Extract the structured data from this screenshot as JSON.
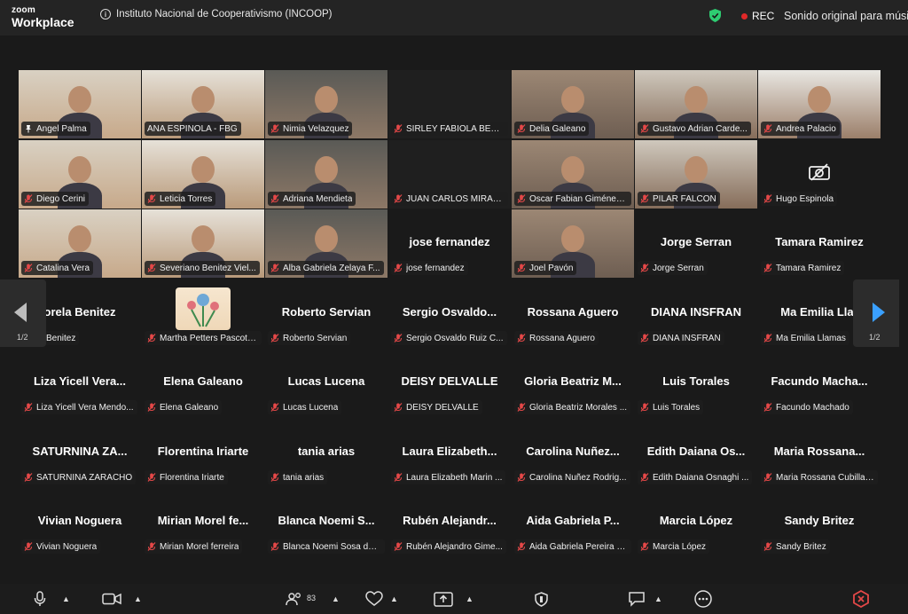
{
  "app": {
    "brand_line1": "zoom",
    "brand_line2": "Workplace"
  },
  "meeting": {
    "title": "Instituto Nacional de Cooperativismo (INCOOP)",
    "rec_label": "REC",
    "audio_label": "Sonido original para músi"
  },
  "pagination": {
    "left": "1/2",
    "right": "1/2"
  },
  "participant_count": "83",
  "rows": [
    [
      {
        "display": "",
        "label": "Angel Palma",
        "kind": "video",
        "icon": "pin-icon"
      },
      {
        "display": "",
        "label": "ANA ESPINOLA - FBG",
        "kind": "video",
        "icon": ""
      },
      {
        "display": "",
        "label": "Nimia Velazquez",
        "kind": "video",
        "icon": "mic-off-icon"
      },
      {
        "display": "",
        "label": "SIRLEY FABIOLA BENIT...",
        "kind": "dark",
        "icon": "mic-off-icon"
      },
      {
        "display": "",
        "label": "Delia Galeano",
        "kind": "video",
        "icon": "mic-off-icon"
      },
      {
        "display": "",
        "label": "Gustavo Adrian Carde...",
        "kind": "video",
        "icon": "mic-off-icon"
      },
      {
        "display": "",
        "label": "Andrea Palacio",
        "kind": "video",
        "icon": "mic-off-icon"
      }
    ],
    [
      {
        "display": "",
        "label": "Diego Cerini",
        "kind": "video",
        "icon": "mic-off-icon"
      },
      {
        "display": "",
        "label": "Leticia Torres",
        "kind": "video",
        "icon": "mic-off-icon"
      },
      {
        "display": "",
        "label": "Adriana Mendieta",
        "kind": "video",
        "icon": "mic-off-icon"
      },
      {
        "display": "",
        "label": "JUAN CARLOS MIRAN...",
        "kind": "dark",
        "icon": "mic-off-icon"
      },
      {
        "display": "",
        "label": "Oscar Fabian Giménez ...",
        "kind": "video",
        "icon": "mic-off-icon"
      },
      {
        "display": "",
        "label": "PILAR FALCON",
        "kind": "video",
        "icon": "mic-off-icon"
      },
      {
        "display": "",
        "label": "Hugo Espinola",
        "kind": "camera-off",
        "icon": "mic-off-icon"
      }
    ],
    [
      {
        "display": "",
        "label": "Catalina Vera",
        "kind": "video",
        "icon": "mic-off-icon"
      },
      {
        "display": "",
        "label": "Severiano Benitez Viel...",
        "kind": "video",
        "icon": "mic-off-icon"
      },
      {
        "display": "",
        "label": "Alba Gabriela Zelaya F...",
        "kind": "video",
        "icon": "mic-off-icon"
      },
      {
        "display": "jose fernandez",
        "label": "jose fernandez",
        "kind": "name",
        "icon": "mic-off-icon"
      },
      {
        "display": "",
        "label": "Joel Pavón",
        "kind": "video",
        "icon": "mic-off-icon"
      },
      {
        "display": "Jorge Serran",
        "label": "Jorge Serran",
        "kind": "name",
        "icon": "mic-off-icon"
      },
      {
        "display": "Tamara Ramirez",
        "label": "Tamara Ramirez",
        "kind": "name",
        "icon": "mic-off-icon"
      }
    ],
    [
      {
        "display": "orela Benitez",
        "label": "orela Benitez",
        "kind": "name",
        "icon": ""
      },
      {
        "display": "",
        "label": "Martha Petters Pascotti...",
        "kind": "avatar",
        "icon": "mic-off-icon"
      },
      {
        "display": "Roberto Servian",
        "label": "Roberto Servian",
        "kind": "name",
        "icon": "mic-off-icon"
      },
      {
        "display": "Sergio Osvaldo...",
        "label": "Sergio Osvaldo Ruiz C...",
        "kind": "name",
        "icon": "mic-off-icon"
      },
      {
        "display": "Rossana Aguero",
        "label": "Rossana Aguero",
        "kind": "name",
        "icon": "mic-off-icon"
      },
      {
        "display": "DIANA INSFRAN",
        "label": "DIANA INSFRAN",
        "kind": "name",
        "icon": "mic-off-icon"
      },
      {
        "display": "Ma Emilia Llar",
        "label": "Ma Emilia Llamas",
        "kind": "name",
        "icon": "mic-off-icon"
      }
    ],
    [
      {
        "display": "Liza Yicell Vera...",
        "label": "Liza Yicell Vera Mendo...",
        "kind": "name",
        "icon": "mic-off-icon"
      },
      {
        "display": "Elena Galeano",
        "label": "Elena Galeano",
        "kind": "name",
        "icon": "mic-off-icon"
      },
      {
        "display": "Lucas Lucena",
        "label": "Lucas Lucena",
        "kind": "name",
        "icon": "mic-off-icon"
      },
      {
        "display": "DEISY DELVALLE",
        "label": "DEISY DELVALLE",
        "kind": "name",
        "icon": "mic-off-icon"
      },
      {
        "display": "Gloria Beatriz M...",
        "label": "Gloria Beatriz Morales ...",
        "kind": "name",
        "icon": "mic-off-icon"
      },
      {
        "display": "Luis Torales",
        "label": "Luis Torales",
        "kind": "name",
        "icon": "mic-off-icon"
      },
      {
        "display": "Facundo Macha...",
        "label": "Facundo Machado",
        "kind": "name",
        "icon": "mic-off-icon"
      }
    ],
    [
      {
        "display": "SATURNINA ZA...",
        "label": "SATURNINA ZARACHO",
        "kind": "name",
        "icon": "mic-off-icon"
      },
      {
        "display": "Florentina Iriarte",
        "label": "Florentina Iriarte",
        "kind": "name",
        "icon": "mic-off-icon"
      },
      {
        "display": "tania arias",
        "label": "tania arias",
        "kind": "name",
        "icon": "mic-off-icon"
      },
      {
        "display": "Laura Elizabeth...",
        "label": "Laura Elizabeth Marin ...",
        "kind": "name",
        "icon": "mic-off-icon"
      },
      {
        "display": "Carolina Nuñez...",
        "label": "Carolina Nuñez Rodrig...",
        "kind": "name",
        "icon": "mic-off-icon"
      },
      {
        "display": "Edith Daiana Os...",
        "label": "Edith Daiana Osnaghi ...",
        "kind": "name",
        "icon": "mic-off-icon"
      },
      {
        "display": "Maria Rossana...",
        "label": "Maria Rossana Cubilla ...",
        "kind": "name",
        "icon": "mic-off-icon"
      }
    ],
    [
      {
        "display": "Vivian Noguera",
        "label": "Vivian Noguera",
        "kind": "name",
        "icon": "mic-off-icon"
      },
      {
        "display": "Mirian Morel fe...",
        "label": "Mirian Morel ferreira",
        "kind": "name",
        "icon": "mic-off-icon"
      },
      {
        "display": "Blanca Noemi S...",
        "label": "Blanca Noemi Sosa de ...",
        "kind": "name",
        "icon": "mic-off-icon"
      },
      {
        "display": "Rubén Alejandr...",
        "label": "Rubén Alejandro Gime...",
        "kind": "name",
        "icon": "mic-off-icon"
      },
      {
        "display": "Aida Gabriela P...",
        "label": "Aida Gabriela Pereira d...",
        "kind": "name",
        "icon": "mic-off-icon"
      },
      {
        "display": "Marcia López",
        "label": "Marcia López",
        "kind": "name",
        "icon": "mic-off-icon"
      },
      {
        "display": "Sandy Britez",
        "label": "Sandy Britez",
        "kind": "name",
        "icon": "mic-off-icon"
      }
    ]
  ],
  "toolbar": {
    "icons": [
      "microphone-icon",
      "video-camera-icon",
      "participants-icon",
      "reactions-heart-icon",
      "share-screen-icon",
      "security-shield-icon",
      "chat-icon",
      "more-options-icon",
      "leave-icon"
    ]
  },
  "colors": {
    "active_speaker": "#2ecc71",
    "muted_red": "#e54848",
    "rec_red": "#e02828",
    "nav_arrow": "#3aa0ff",
    "background": "#1a1a1a"
  }
}
